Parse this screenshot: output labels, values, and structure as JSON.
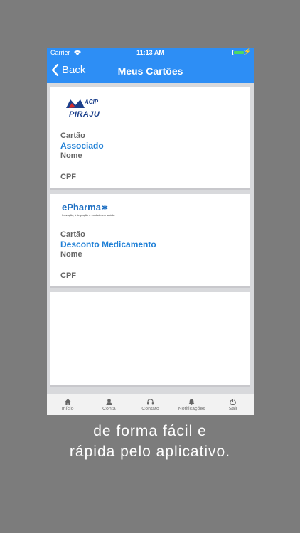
{
  "status_bar": {
    "carrier": "Carrier",
    "time": "11:13 AM"
  },
  "navbar": {
    "back_label": "Back",
    "title": "Meus Cartões"
  },
  "cards": [
    {
      "logo": {
        "brand": "ACIP",
        "city": "PIRAJU"
      },
      "card_label": "Cartão",
      "card_value": "Associado",
      "name_label": "Nome",
      "cpf_label": "CPF"
    },
    {
      "logo": {
        "brand": "ePharma",
        "tagline": "Inovação, integração e cuidado em saúde."
      },
      "card_label": "Cartão",
      "card_value": "Desconto Medicamento",
      "name_label": "Nome",
      "cpf_label": "CPF"
    }
  ],
  "tabbar": {
    "items": [
      {
        "label": "Início",
        "icon": "home-icon"
      },
      {
        "label": "Conta",
        "icon": "user-icon"
      },
      {
        "label": "Contato",
        "icon": "headphones-icon"
      },
      {
        "label": "Notificações",
        "icon": "bell-icon"
      },
      {
        "label": "Sair",
        "icon": "power-icon"
      }
    ]
  },
  "caption": {
    "line1": "de forma fácil e",
    "line2": "rápida pelo aplicativo."
  },
  "colors": {
    "accent": "#2d8ef5",
    "value_text": "#1e7fd6",
    "background": "#7c7c7c"
  }
}
